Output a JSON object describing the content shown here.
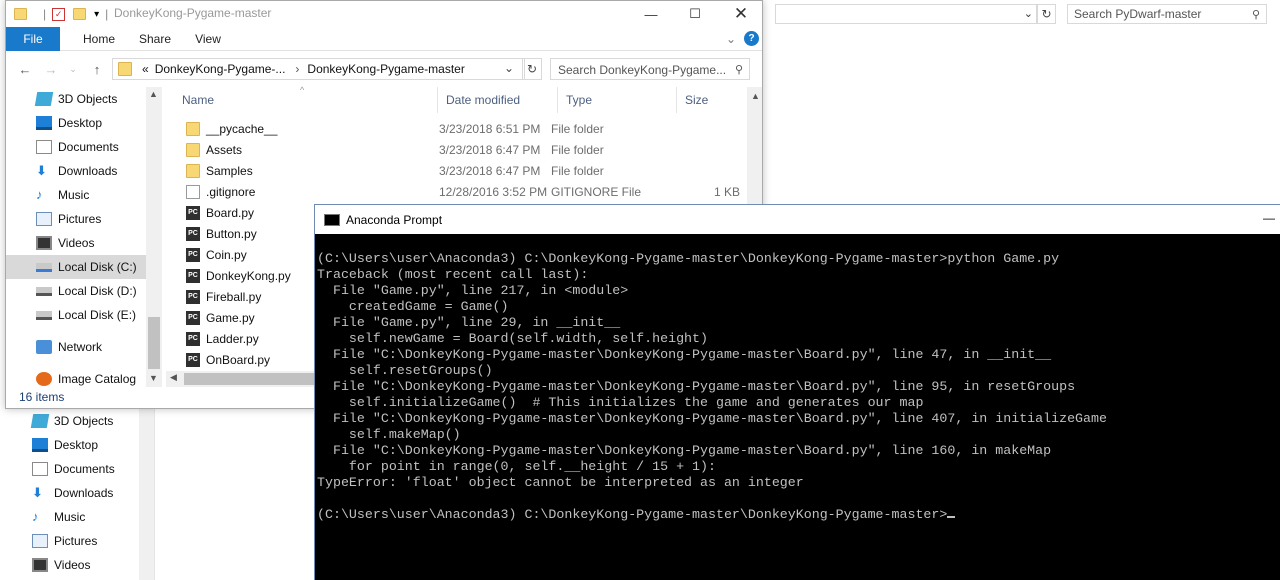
{
  "background_window": {
    "search_placeholder": "Search PyDwarf-master",
    "nav_items": [
      {
        "label": "3D Objects",
        "icon": "3d-objects-icon"
      },
      {
        "label": "Desktop",
        "icon": "desktop-icon"
      },
      {
        "label": "Documents",
        "icon": "documents-icon"
      },
      {
        "label": "Downloads",
        "icon": "downloads-icon"
      },
      {
        "label": "Music",
        "icon": "music-icon"
      },
      {
        "label": "Pictures",
        "icon": "pictures-icon"
      },
      {
        "label": "Videos",
        "icon": "videos-icon"
      }
    ]
  },
  "explorer": {
    "title": "DonkeyKong-Pygame-master",
    "ribbon_tabs": {
      "file": "File",
      "home": "Home",
      "share": "Share",
      "view": "View"
    },
    "breadcrumb": {
      "lead": "«",
      "parent": "DonkeyKong-Pygame-...",
      "current": "DonkeyKong-Pygame-master"
    },
    "search_placeholder": "Search DonkeyKong-Pygame...",
    "nav_items": [
      {
        "label": "3D Objects",
        "icon": "3d-objects-icon"
      },
      {
        "label": "Desktop",
        "icon": "desktop-icon"
      },
      {
        "label": "Documents",
        "icon": "documents-icon"
      },
      {
        "label": "Downloads",
        "icon": "downloads-icon"
      },
      {
        "label": "Music",
        "icon": "music-icon"
      },
      {
        "label": "Pictures",
        "icon": "pictures-icon"
      },
      {
        "label": "Videos",
        "icon": "videos-icon"
      },
      {
        "label": "Local Disk (C:)",
        "icon": "drive-c-icon",
        "selected": true
      },
      {
        "label": "Local Disk (D:)",
        "icon": "drive-icon"
      },
      {
        "label": "Local Disk (E:)",
        "icon": "drive-icon"
      },
      {
        "label": "Network",
        "icon": "network-icon"
      },
      {
        "label": "Image Catalog",
        "icon": "image-catalog-icon"
      }
    ],
    "columns": {
      "name": "Name",
      "date": "Date modified",
      "type": "Type",
      "size": "Size"
    },
    "files": [
      {
        "name": "__pycache__",
        "date": "3/23/2018 6:51 PM",
        "type": "File folder",
        "size": "",
        "kind": "folder"
      },
      {
        "name": "Assets",
        "date": "3/23/2018 6:47 PM",
        "type": "File folder",
        "size": "",
        "kind": "folder"
      },
      {
        "name": "Samples",
        "date": "3/23/2018 6:47 PM",
        "type": "File folder",
        "size": "",
        "kind": "folder"
      },
      {
        "name": ".gitignore",
        "date": "12/28/2016 3:52 PM",
        "type": "GITIGNORE File",
        "size": "1 KB",
        "kind": "file"
      },
      {
        "name": "Board.py",
        "date": "",
        "type": "",
        "size": "",
        "kind": "py"
      },
      {
        "name": "Button.py",
        "date": "",
        "type": "",
        "size": "",
        "kind": "py"
      },
      {
        "name": "Coin.py",
        "date": "",
        "type": "",
        "size": "",
        "kind": "py"
      },
      {
        "name": "DonkeyKong.py",
        "date": "",
        "type": "",
        "size": "",
        "kind": "py"
      },
      {
        "name": "Fireball.py",
        "date": "",
        "type": "",
        "size": "",
        "kind": "py"
      },
      {
        "name": "Game.py",
        "date": "",
        "type": "",
        "size": "",
        "kind": "py"
      },
      {
        "name": "Ladder.py",
        "date": "",
        "type": "",
        "size": "",
        "kind": "py"
      },
      {
        "name": "OnBoard.py",
        "date": "",
        "type": "",
        "size": "",
        "kind": "py"
      }
    ],
    "status": "16 items"
  },
  "prompt": {
    "title": "Anaconda Prompt",
    "lines": [
      "(C:\\Users\\user\\Anaconda3) C:\\DonkeyKong-Pygame-master\\DonkeyKong-Pygame-master>python Game.py",
      "Traceback (most recent call last):",
      "  File \"Game.py\", line 217, in <module>",
      "    createdGame = Game()",
      "  File \"Game.py\", line 29, in __init__",
      "    self.newGame = Board(self.width, self.height)",
      "  File \"C:\\DonkeyKong-Pygame-master\\DonkeyKong-Pygame-master\\Board.py\", line 47, in __init__",
      "    self.resetGroups()",
      "  File \"C:\\DonkeyKong-Pygame-master\\DonkeyKong-Pygame-master\\Board.py\", line 95, in resetGroups",
      "    self.initializeGame()  # This initializes the game and generates our map",
      "  File \"C:\\DonkeyKong-Pygame-master\\DonkeyKong-Pygame-master\\Board.py\", line 407, in initializeGame",
      "    self.makeMap()",
      "  File \"C:\\DonkeyKong-Pygame-master\\DonkeyKong-Pygame-master\\Board.py\", line 160, in makeMap",
      "    for point in range(0, self.__height / 15 + 1):",
      "TypeError: 'float' object cannot be interpreted as an integer",
      "",
      "(C:\\Users\\user\\Anaconda3) C:\\DonkeyKong-Pygame-master\\DonkeyKong-Pygame-master>"
    ]
  }
}
